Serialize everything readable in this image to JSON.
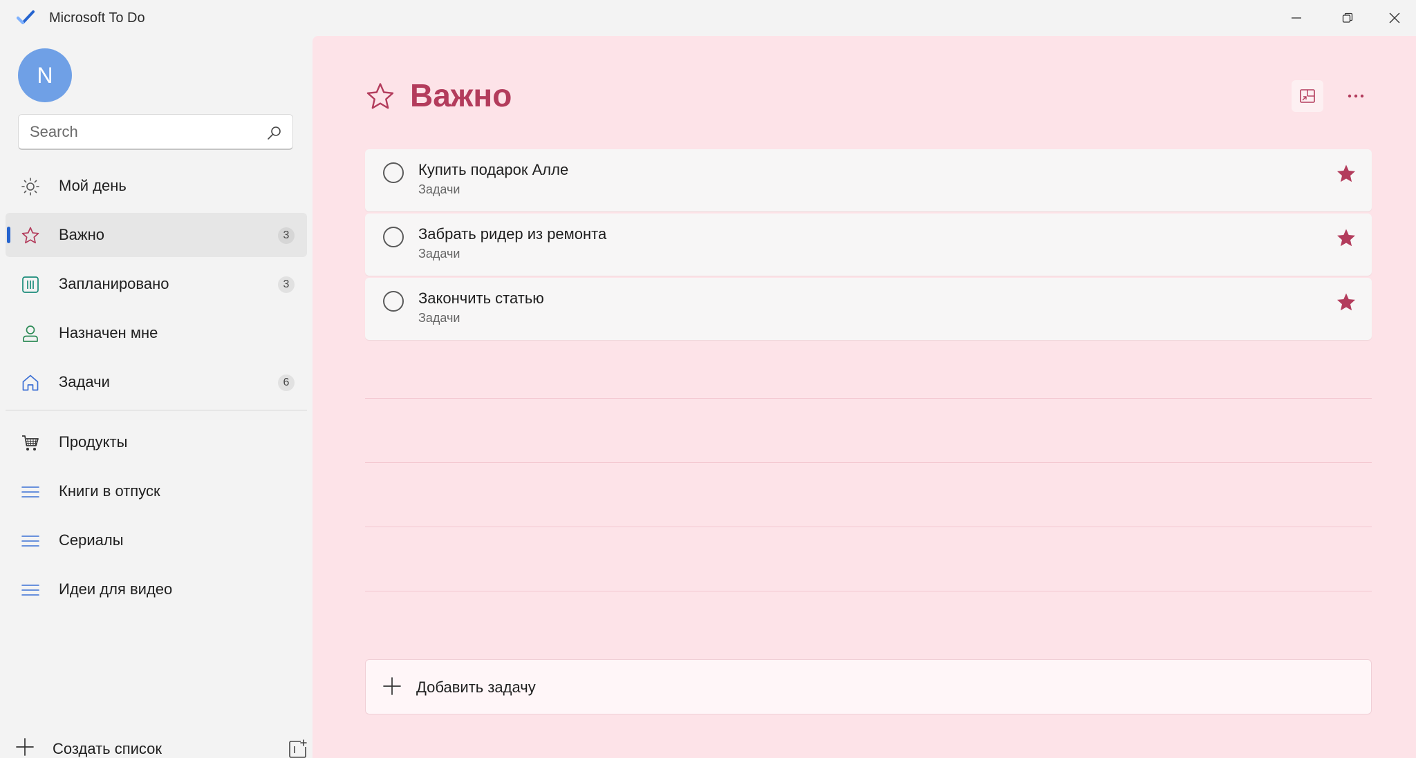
{
  "window": {
    "title": "Microsoft To Do"
  },
  "user": {
    "initial": "N"
  },
  "search": {
    "placeholder": "Search"
  },
  "sidebar": {
    "items": [
      {
        "label": "Мой день",
        "count": null,
        "icon": "sun-icon"
      },
      {
        "label": "Важно",
        "count": "3",
        "icon": "star-icon",
        "active": true
      },
      {
        "label": "Запланировано",
        "count": "3",
        "icon": "calendar-icon"
      },
      {
        "label": "Назначен мне",
        "count": null,
        "icon": "person-icon"
      },
      {
        "label": "Задачи",
        "count": "6",
        "icon": "home-icon"
      }
    ],
    "lists": [
      {
        "label": "Продукты",
        "icon": "shopping-cart-icon"
      },
      {
        "label": "Книги в отпуск",
        "icon": "list-icon"
      },
      {
        "label": "Сериалы",
        "icon": "list-icon"
      },
      {
        "label": "Идеи для видео",
        "icon": "list-icon"
      }
    ],
    "new_list_label": "Создать список"
  },
  "main": {
    "title": "Важно",
    "tasks": [
      {
        "title": "Купить подарок Алле",
        "list": "Задачи",
        "important": true
      },
      {
        "title": "Забрать ридер из ремонта",
        "list": "Задачи",
        "important": true
      },
      {
        "title": "Закончить статью",
        "list": "Задачи",
        "important": true
      }
    ],
    "add_task_placeholder": "Добавить задачу"
  },
  "colors": {
    "accent": "#b33c5c",
    "background": "#fde3e8",
    "selection_indicator": "#2564cf"
  }
}
